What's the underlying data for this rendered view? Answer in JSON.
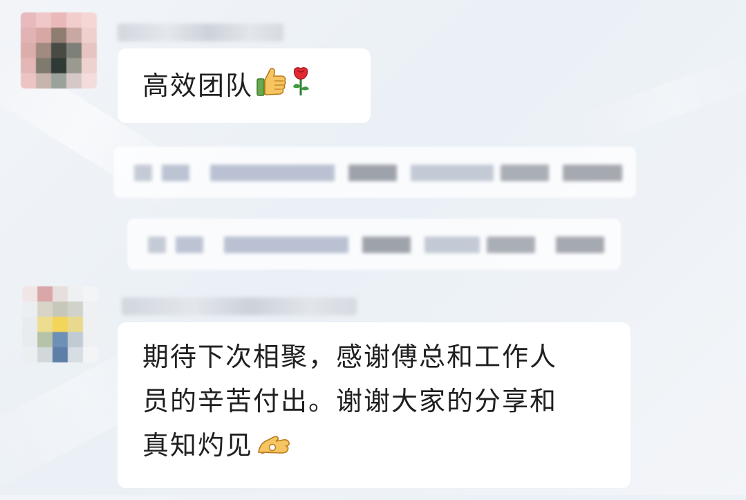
{
  "chat": {
    "messages": [
      {
        "id": "msg-1",
        "sender_name_visible": false,
        "text": "高效团队",
        "emojis": [
          "thumbs-up-icon",
          "rose-icon"
        ]
      },
      {
        "id": "msg-2",
        "redacted": true
      },
      {
        "id": "msg-3",
        "redacted": true
      },
      {
        "id": "msg-4",
        "sender_name_visible": false,
        "text_line_1": "期待下次相聚，感谢傅总和工作人",
        "text_line_2": "员的辛苦付出。谢谢大家的分享和",
        "text_line_3": "真知灼见",
        "emojis": [
          "ok-hand-icon"
        ]
      }
    ]
  },
  "colors": {
    "bubble_bg": "#ffffff",
    "text": "#1f1f1f",
    "background": "#eef2f6"
  }
}
